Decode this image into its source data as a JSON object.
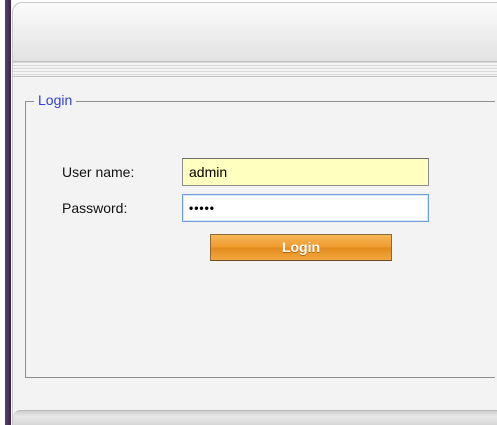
{
  "login": {
    "legend": "Login",
    "username_label": "User name:",
    "username_value": "admin",
    "password_label": "Password:",
    "password_value": "•••••",
    "button_label": "Login"
  },
  "colors": {
    "legend_text": "#3340d0",
    "username_field_bg": "#ffffc0",
    "button_orange": "#ef9b2b"
  }
}
